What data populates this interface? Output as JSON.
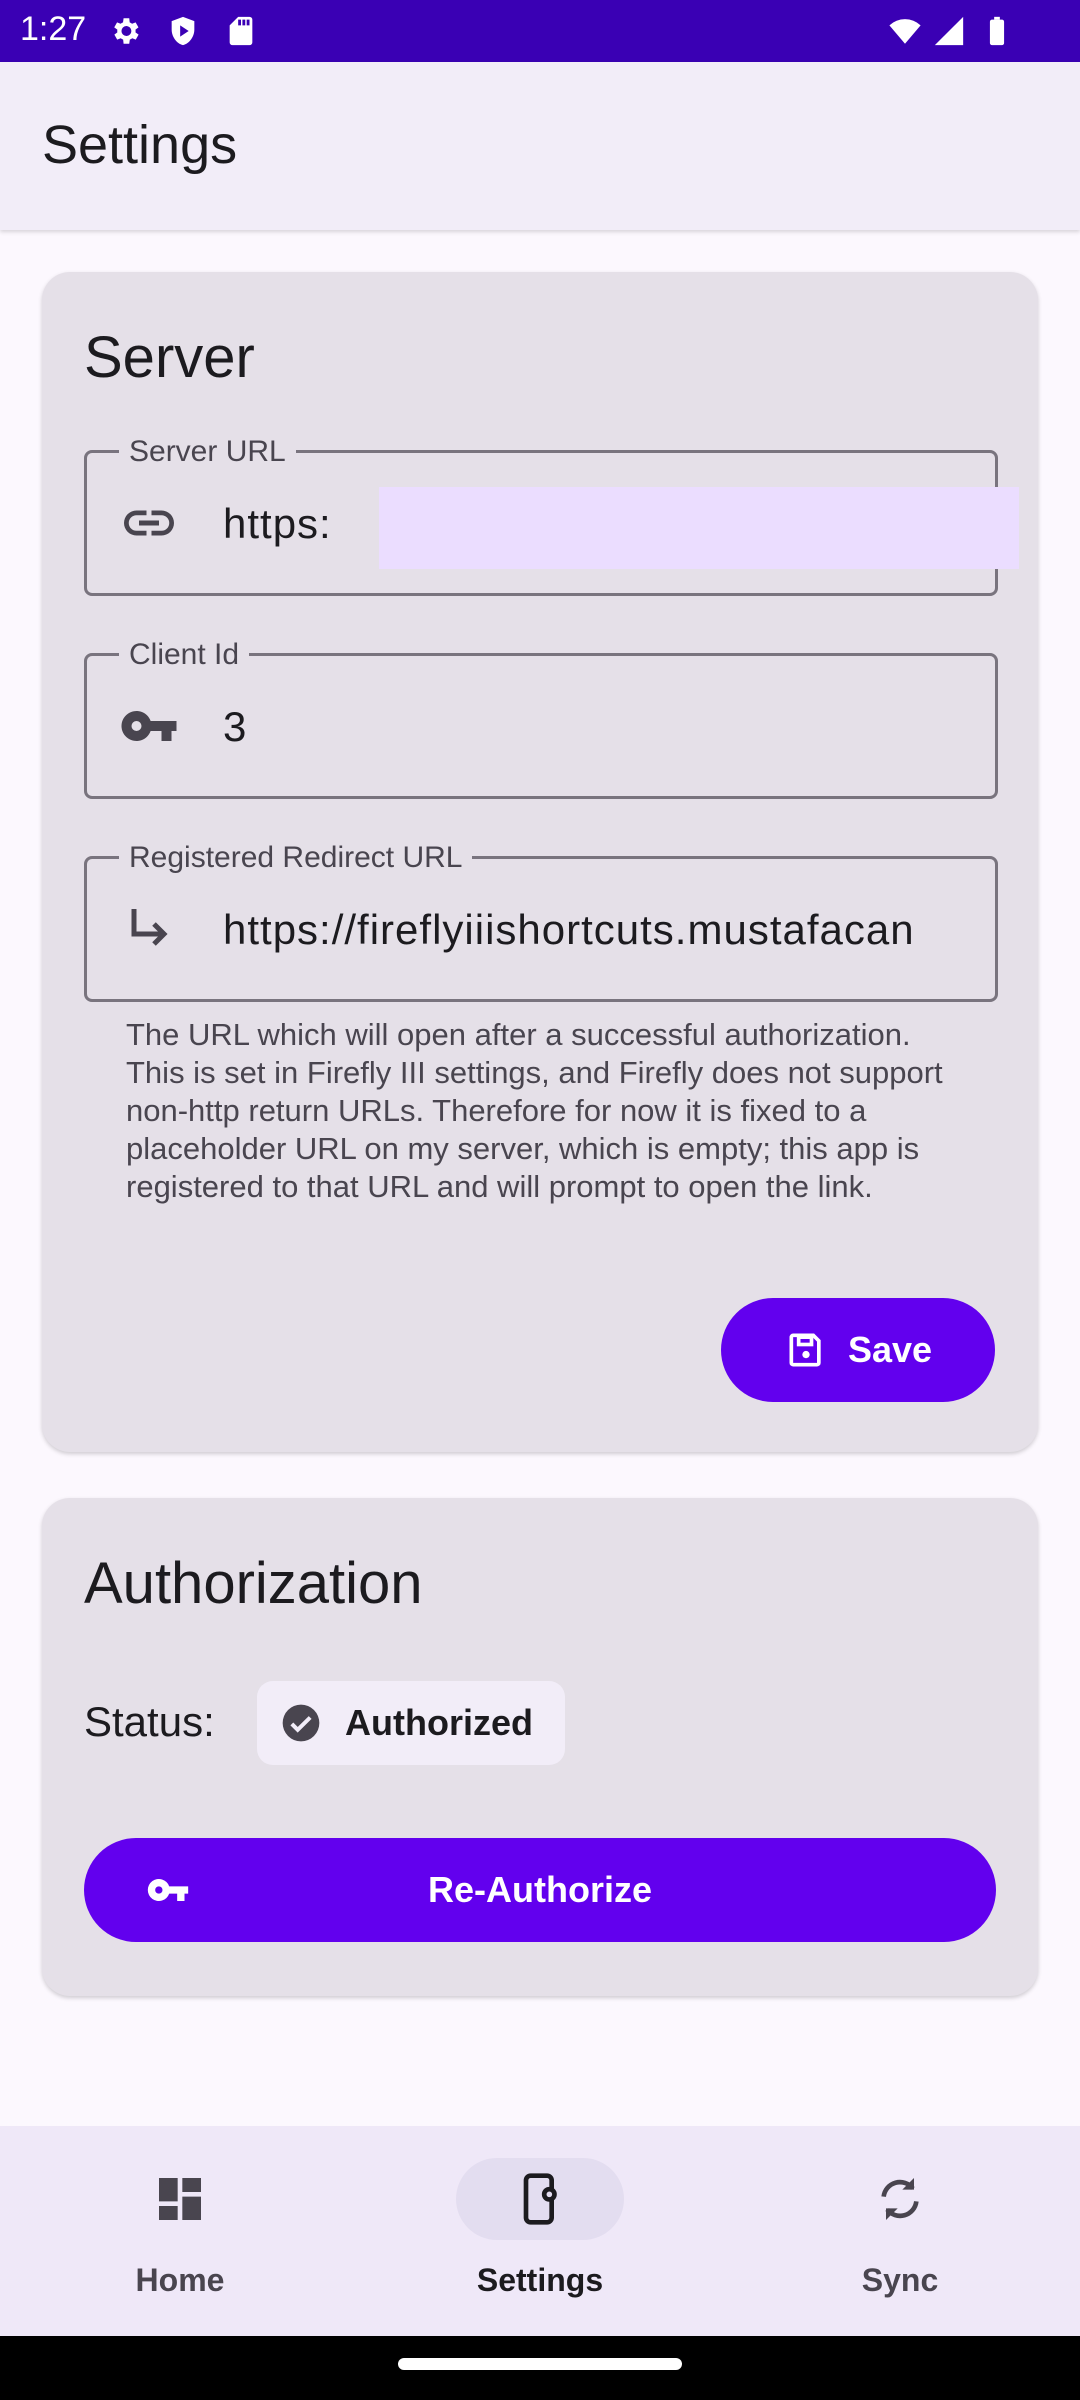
{
  "status_bar": {
    "time": "1:27",
    "left_icons": [
      "gear-icon",
      "shield-icon",
      "sd-card-icon"
    ],
    "right_icons": [
      "wifi-icon",
      "signal-icon",
      "battery-icon"
    ]
  },
  "app_bar": {
    "title": "Settings"
  },
  "server_card": {
    "title": "Server",
    "server_url": {
      "label": "Server URL",
      "value": "https:",
      "icon": "link-icon"
    },
    "client_id": {
      "label": "Client Id",
      "value": "3",
      "icon": "key-icon"
    },
    "redirect_url": {
      "label": "Registered Redirect URL",
      "value": "https://fireflyiiishortcuts.mustafacan",
      "icon": "redirect-arrow-icon"
    },
    "helper_text": "The URL which will open after a successful authorization. This is set in Firefly III settings, and Firefly does not support non-http return URLs. Therefore for now it is fixed to a placeholder URL on my server, which is empty; this app is registered to that URL and will prompt to open the link.",
    "save_label": "Save"
  },
  "auth_card": {
    "title": "Authorization",
    "status_label": "Status:",
    "status_value": "Authorized",
    "reauth_label": "Re-Authorize"
  },
  "bottom_nav": {
    "items": [
      {
        "label": "Home",
        "icon": "dashboard-icon",
        "active": false
      },
      {
        "label": "Settings",
        "icon": "phone-settings-icon",
        "active": true
      },
      {
        "label": "Sync",
        "icon": "sync-icon",
        "active": false
      }
    ]
  },
  "colors": {
    "primary": "#6200EE",
    "status_bar": "#3A00B4",
    "card_bg": "#E5E0E8",
    "url_selection": "#EBDDFF"
  }
}
